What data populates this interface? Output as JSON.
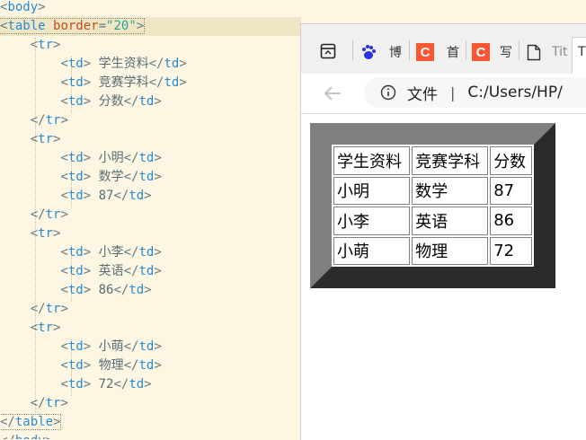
{
  "editor": {
    "lines": [
      {
        "indent": "",
        "parts": [
          {
            "t": "<",
            "c": "punct"
          },
          {
            "t": "body",
            "c": "tag"
          },
          {
            "t": ">",
            "c": "punct"
          }
        ]
      },
      {
        "indent": "",
        "highlight": true,
        "parts": [
          {
            "t": "<",
            "c": "punct"
          },
          {
            "t": "table",
            "c": "tag"
          },
          {
            "t": " border",
            "c": "attr"
          },
          {
            "t": "=",
            "c": "punct"
          },
          {
            "t": "\"20\"",
            "c": "str"
          },
          {
            "t": ">",
            "c": "punct"
          }
        ]
      },
      {
        "indent": "    ",
        "parts": [
          {
            "t": "<",
            "c": "punct"
          },
          {
            "t": "tr",
            "c": "tag"
          },
          {
            "t": ">",
            "c": "punct"
          }
        ]
      },
      {
        "indent": "        ",
        "parts": [
          {
            "t": "<",
            "c": "punct"
          },
          {
            "t": "td",
            "c": "tag"
          },
          {
            "t": "> ",
            "c": "punct"
          },
          {
            "t": "学生资料",
            "c": "txt"
          },
          {
            "t": "</",
            "c": "punct"
          },
          {
            "t": "td",
            "c": "tag"
          },
          {
            "t": ">",
            "c": "punct"
          }
        ]
      },
      {
        "indent": "        ",
        "parts": [
          {
            "t": "<",
            "c": "punct"
          },
          {
            "t": "td",
            "c": "tag"
          },
          {
            "t": "> ",
            "c": "punct"
          },
          {
            "t": "竞赛学科",
            "c": "txt"
          },
          {
            "t": "</",
            "c": "punct"
          },
          {
            "t": "td",
            "c": "tag"
          },
          {
            "t": ">",
            "c": "punct"
          }
        ]
      },
      {
        "indent": "        ",
        "parts": [
          {
            "t": "<",
            "c": "punct"
          },
          {
            "t": "td",
            "c": "tag"
          },
          {
            "t": "> ",
            "c": "punct"
          },
          {
            "t": "分数",
            "c": "txt"
          },
          {
            "t": "</",
            "c": "punct"
          },
          {
            "t": "td",
            "c": "tag"
          },
          {
            "t": ">",
            "c": "punct"
          }
        ]
      },
      {
        "indent": "    ",
        "parts": [
          {
            "t": "</",
            "c": "punct"
          },
          {
            "t": "tr",
            "c": "tag"
          },
          {
            "t": ">",
            "c": "punct"
          }
        ]
      },
      {
        "indent": "    ",
        "parts": [
          {
            "t": "<",
            "c": "punct"
          },
          {
            "t": "tr",
            "c": "tag"
          },
          {
            "t": ">",
            "c": "punct"
          }
        ]
      },
      {
        "indent": "        ",
        "parts": [
          {
            "t": "<",
            "c": "punct"
          },
          {
            "t": "td",
            "c": "tag"
          },
          {
            "t": "> ",
            "c": "punct"
          },
          {
            "t": "小明",
            "c": "txt"
          },
          {
            "t": "</",
            "c": "punct"
          },
          {
            "t": "td",
            "c": "tag"
          },
          {
            "t": ">",
            "c": "punct"
          }
        ]
      },
      {
        "indent": "        ",
        "parts": [
          {
            "t": "<",
            "c": "punct"
          },
          {
            "t": "td",
            "c": "tag"
          },
          {
            "t": "> ",
            "c": "punct"
          },
          {
            "t": "数学",
            "c": "txt"
          },
          {
            "t": "</",
            "c": "punct"
          },
          {
            "t": "td",
            "c": "tag"
          },
          {
            "t": ">",
            "c": "punct"
          }
        ]
      },
      {
        "indent": "        ",
        "parts": [
          {
            "t": "<",
            "c": "punct"
          },
          {
            "t": "td",
            "c": "tag"
          },
          {
            "t": "> ",
            "c": "punct"
          },
          {
            "t": "87",
            "c": "txt"
          },
          {
            "t": "</",
            "c": "punct"
          },
          {
            "t": "td",
            "c": "tag"
          },
          {
            "t": ">",
            "c": "punct"
          }
        ]
      },
      {
        "indent": "    ",
        "parts": [
          {
            "t": "</",
            "c": "punct"
          },
          {
            "t": "tr",
            "c": "tag"
          },
          {
            "t": ">",
            "c": "punct"
          }
        ]
      },
      {
        "indent": "    ",
        "parts": [
          {
            "t": "<",
            "c": "punct"
          },
          {
            "t": "tr",
            "c": "tag"
          },
          {
            "t": ">",
            "c": "punct"
          }
        ]
      },
      {
        "indent": "        ",
        "parts": [
          {
            "t": "<",
            "c": "punct"
          },
          {
            "t": "td",
            "c": "tag"
          },
          {
            "t": "> ",
            "c": "punct"
          },
          {
            "t": "小李",
            "c": "txt"
          },
          {
            "t": "</",
            "c": "punct"
          },
          {
            "t": "td",
            "c": "tag"
          },
          {
            "t": ">",
            "c": "punct"
          }
        ]
      },
      {
        "indent": "        ",
        "parts": [
          {
            "t": "<",
            "c": "punct"
          },
          {
            "t": "td",
            "c": "tag"
          },
          {
            "t": "> ",
            "c": "punct"
          },
          {
            "t": "英语",
            "c": "txt"
          },
          {
            "t": "</",
            "c": "punct"
          },
          {
            "t": "td",
            "c": "tag"
          },
          {
            "t": ">",
            "c": "punct"
          }
        ]
      },
      {
        "indent": "        ",
        "parts": [
          {
            "t": "<",
            "c": "punct"
          },
          {
            "t": "td",
            "c": "tag"
          },
          {
            "t": "> ",
            "c": "punct"
          },
          {
            "t": "86",
            "c": "txt"
          },
          {
            "t": "</",
            "c": "punct"
          },
          {
            "t": "td",
            "c": "tag"
          },
          {
            "t": ">",
            "c": "punct"
          }
        ]
      },
      {
        "indent": "    ",
        "parts": [
          {
            "t": "</",
            "c": "punct"
          },
          {
            "t": "tr",
            "c": "tag"
          },
          {
            "t": ">",
            "c": "punct"
          }
        ]
      },
      {
        "indent": "    ",
        "parts": [
          {
            "t": "<",
            "c": "punct"
          },
          {
            "t": "tr",
            "c": "tag"
          },
          {
            "t": ">",
            "c": "punct"
          }
        ]
      },
      {
        "indent": "        ",
        "parts": [
          {
            "t": "<",
            "c": "punct"
          },
          {
            "t": "td",
            "c": "tag"
          },
          {
            "t": "> ",
            "c": "punct"
          },
          {
            "t": "小萌",
            "c": "txt"
          },
          {
            "t": "</",
            "c": "punct"
          },
          {
            "t": "td",
            "c": "tag"
          },
          {
            "t": ">",
            "c": "punct"
          }
        ]
      },
      {
        "indent": "        ",
        "parts": [
          {
            "t": "<",
            "c": "punct"
          },
          {
            "t": "td",
            "c": "tag"
          },
          {
            "t": "> ",
            "c": "punct"
          },
          {
            "t": "物理",
            "c": "txt"
          },
          {
            "t": "</",
            "c": "punct"
          },
          {
            "t": "td",
            "c": "tag"
          },
          {
            "t": ">",
            "c": "punct"
          }
        ]
      },
      {
        "indent": "        ",
        "parts": [
          {
            "t": "<",
            "c": "punct"
          },
          {
            "t": "td",
            "c": "tag"
          },
          {
            "t": "> ",
            "c": "punct"
          },
          {
            "t": "72",
            "c": "txt"
          },
          {
            "t": "</",
            "c": "punct"
          },
          {
            "t": "td",
            "c": "tag"
          },
          {
            "t": ">",
            "c": "punct"
          }
        ]
      },
      {
        "indent": "    ",
        "parts": [
          {
            "t": "</",
            "c": "punct"
          },
          {
            "t": "tr",
            "c": "tag"
          },
          {
            "t": ">",
            "c": "punct"
          }
        ]
      },
      {
        "indent": "",
        "boxed": true,
        "parts": [
          {
            "t": "</",
            "c": "punct"
          },
          {
            "t": "table",
            "c": "tag"
          },
          {
            "t": ">",
            "c": "punct"
          }
        ]
      },
      {
        "indent": "",
        "parts": [
          {
            "t": "</",
            "c": "punct"
          },
          {
            "t": "body",
            "c": "tag"
          },
          {
            "t": ">",
            "c": "punct"
          }
        ]
      }
    ]
  },
  "browser": {
    "tabs": [
      {
        "icon": "baidu-paw-icon",
        "title": "博"
      },
      {
        "icon": "csdn-c-icon",
        "title": "首"
      },
      {
        "icon": "csdn-c-icon",
        "title": "写"
      },
      {
        "icon": "page-icon",
        "title": "Tit"
      }
    ],
    "active_tab_label": "T",
    "address": {
      "scheme_label": "文件",
      "separator": "|",
      "path": "C:/Users/HP/"
    },
    "colors": {
      "csdn_red": "#fc5531",
      "baidu_blue": "#2932e1",
      "table_light": "#808080",
      "table_dark": "#2b2b2b"
    }
  },
  "table": {
    "rows": [
      [
        "学生资料",
        "竞赛学科",
        "分数"
      ],
      [
        "小明",
        "数学",
        "87"
      ],
      [
        "小李",
        "英语",
        "86"
      ],
      [
        "小萌",
        "物理",
        "72"
      ]
    ]
  }
}
